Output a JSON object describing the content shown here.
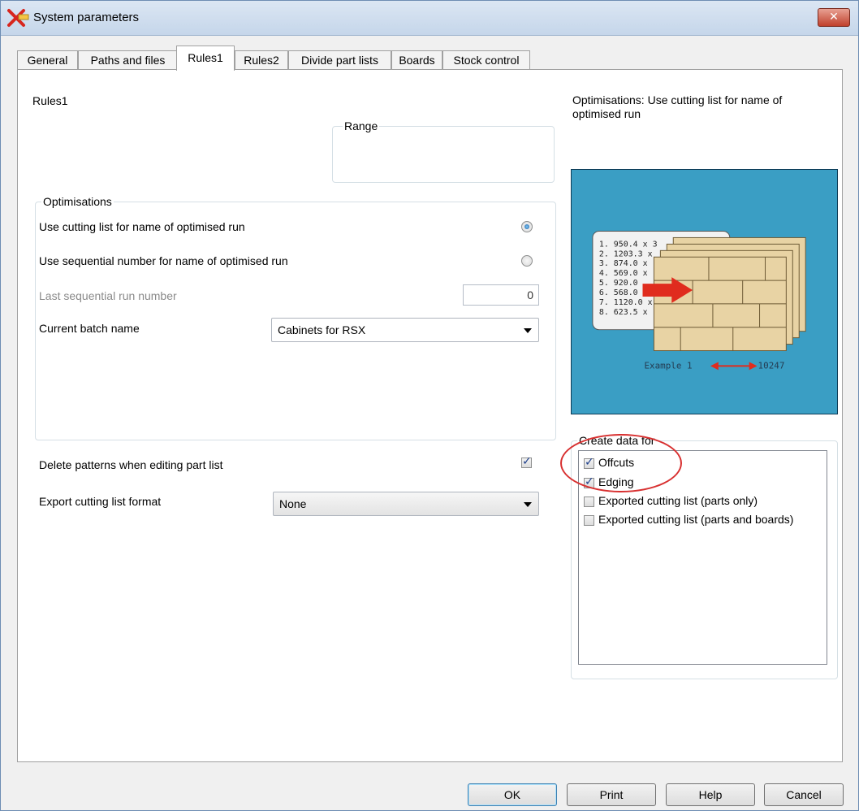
{
  "window": {
    "title": "System parameters"
  },
  "tabs": [
    {
      "label": "General"
    },
    {
      "label": "Paths and files"
    },
    {
      "label": "Rules1"
    },
    {
      "label": "Rules2"
    },
    {
      "label": "Divide part lists"
    },
    {
      "label": "Boards"
    },
    {
      "label": "Stock control"
    }
  ],
  "panel": {
    "heading": "Rules1",
    "range": {
      "legend": "Range"
    },
    "optimisations": {
      "legend": "Optimisations",
      "use_cutting_list_label": "Use cutting list for name of optimised run",
      "use_cutting_list_selected": true,
      "use_sequential_label": "Use sequential number for name of optimised run",
      "use_sequential_selected": false,
      "last_sequential_label": "Last sequential run number",
      "last_sequential_value": "0",
      "batch_name_label": "Current batch name",
      "batch_name_value": "Cabinets for RSX"
    },
    "delete_patterns": {
      "label": "Delete patterns when editing part list",
      "checked": true
    },
    "export_format": {
      "label": "Export cutting list format",
      "value": "None"
    },
    "help_title": "Optimisations: Use cutting list for name of optimised run",
    "preview": {
      "list_lines": [
        "1.  950.4 x 3",
        "2. 1203.3 x",
        "3.  874.0 x",
        "4.  569.0 x",
        "5.  920.0",
        "6.  568.0 x",
        "7. 1120.0 x",
        "8.  623.5 x"
      ],
      "caption_left": "Example 1",
      "caption_right": "10247"
    },
    "create_data": {
      "legend": "Create data for",
      "items": [
        {
          "label": "Offcuts",
          "checked": true
        },
        {
          "label": "Edging",
          "checked": true
        },
        {
          "label": "Exported cutting list (parts only)",
          "checked": false
        },
        {
          "label": "Exported cutting list (parts and boards)",
          "checked": false
        }
      ]
    }
  },
  "buttons": {
    "ok": "OK",
    "print": "Print",
    "help": "Help",
    "cancel": "Cancel"
  },
  "colors": {
    "preview_bg": "#3a9ec4",
    "highlight": "#d83030",
    "board": "#e8d3a4"
  }
}
